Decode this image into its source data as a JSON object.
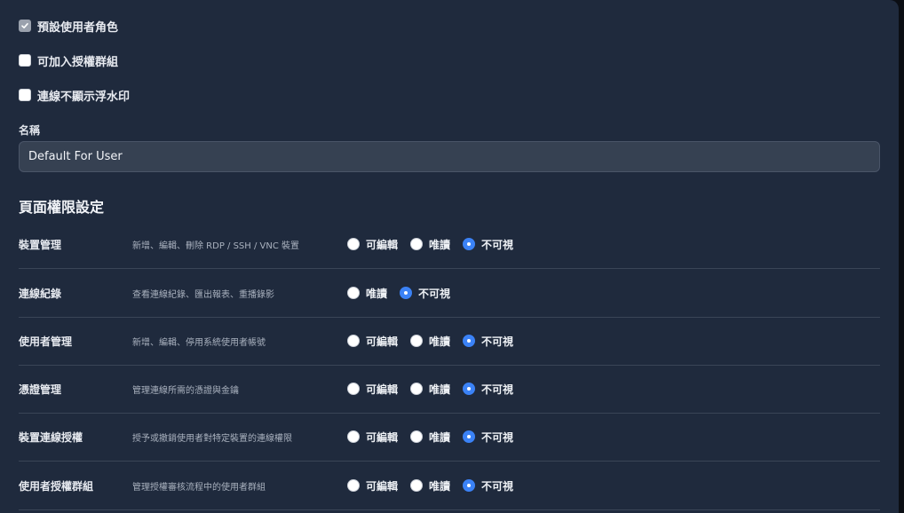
{
  "checkboxes": [
    {
      "label": "預設使用者角色",
      "checked": true
    },
    {
      "label": "可加入授權群組",
      "checked": false
    },
    {
      "label": "連線不顯示浮水印",
      "checked": false
    }
  ],
  "name_field": {
    "label": "名稱",
    "value": "Default For User"
  },
  "permissions": {
    "title": "頁面權限設定",
    "rows": [
      {
        "name": "裝置管理",
        "desc": "新增、編輯、刪除 RDP / SSH / VNC 裝置",
        "options": [
          {
            "label": "可編輯",
            "selected": false
          },
          {
            "label": "唯讀",
            "selected": false
          },
          {
            "label": "不可視",
            "selected": true
          }
        ]
      },
      {
        "name": "連線紀錄",
        "desc": "查看連線紀錄、匯出報表、重播錄影",
        "options": [
          {
            "label": "唯讀",
            "selected": false
          },
          {
            "label": "不可視",
            "selected": true
          }
        ]
      },
      {
        "name": "使用者管理",
        "desc": "新增、編輯、停用系統使用者帳號",
        "options": [
          {
            "label": "可編輯",
            "selected": false
          },
          {
            "label": "唯讀",
            "selected": false
          },
          {
            "label": "不可視",
            "selected": true
          }
        ]
      },
      {
        "name": "憑證管理",
        "desc": "管理連線所需的憑證與金鑰",
        "options": [
          {
            "label": "可編輯",
            "selected": false
          },
          {
            "label": "唯讀",
            "selected": false
          },
          {
            "label": "不可視",
            "selected": true
          }
        ]
      },
      {
        "name": "裝置連線授權",
        "desc": "授予或撤銷使用者對特定裝置的連線權限",
        "options": [
          {
            "label": "可編輯",
            "selected": false
          },
          {
            "label": "唯讀",
            "selected": false
          },
          {
            "label": "不可視",
            "selected": true
          }
        ]
      },
      {
        "name": "使用者授權群組",
        "desc": "管理授權審核流程中的使用者群組",
        "options": [
          {
            "label": "可編輯",
            "selected": false
          },
          {
            "label": "唯讀",
            "selected": false
          },
          {
            "label": "不可視",
            "selected": true
          }
        ]
      }
    ]
  },
  "colors": {
    "panel_bg": "#1f2a3d",
    "accent": "#3b82f6",
    "divider": "#3a4557"
  }
}
